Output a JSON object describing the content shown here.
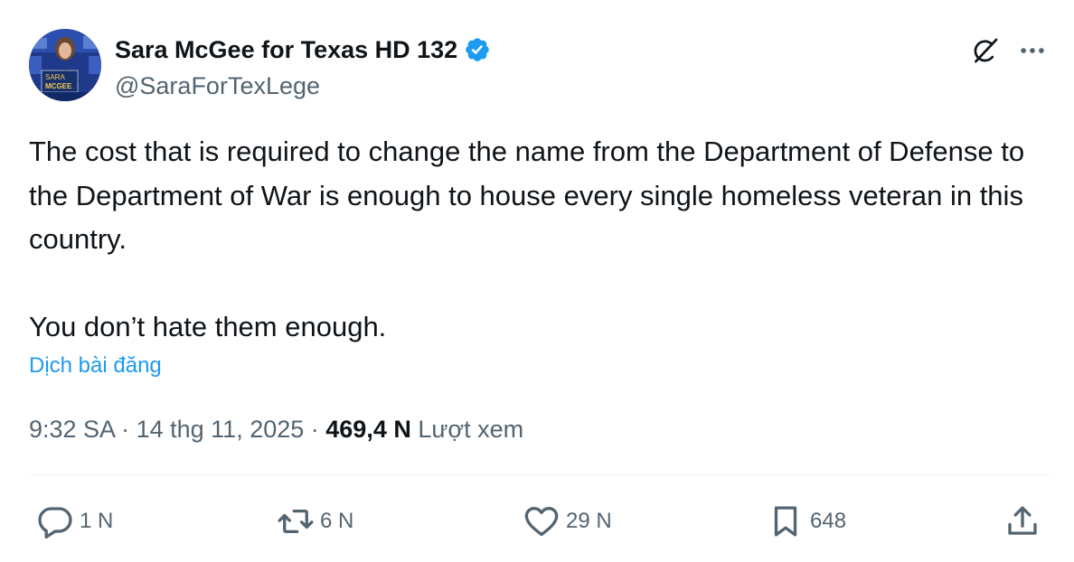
{
  "author": {
    "name": "Sara McGee for Texas HD 132",
    "handle": "@SaraForTexLege",
    "avatar_text_1": "SARA",
    "avatar_text_2": "MCGEE"
  },
  "tweet": {
    "paragraph_1": "The cost that is required to change the name from the Department of Defense to the Department of War is enough to house every single homeless veteran in this country.",
    "paragraph_2": "You don’t hate them enough.",
    "translate_label": "Dịch bài đăng"
  },
  "meta": {
    "time": "9:32 SA",
    "sep_1": " · ",
    "date": "14 thg 11, 2025",
    "sep_2": " · ",
    "views_count": "469,4 N",
    "views_label": " Lượt xem"
  },
  "actions": {
    "replies": "1 N",
    "reposts": "6 N",
    "likes": "29 N",
    "bookmarks": "648"
  },
  "icons": {
    "verified": "verified-badge-icon",
    "grok": "grok-icon",
    "more": "more-icon",
    "reply": "reply-icon",
    "repost": "repost-icon",
    "like": "heart-icon",
    "bookmark": "bookmark-icon",
    "share": "share-icon"
  },
  "colors": {
    "text": "#0f1419",
    "secondary": "#536471",
    "link": "#1d9bf0",
    "verified": "#1d9bf0",
    "divider": "#eff3f4"
  }
}
